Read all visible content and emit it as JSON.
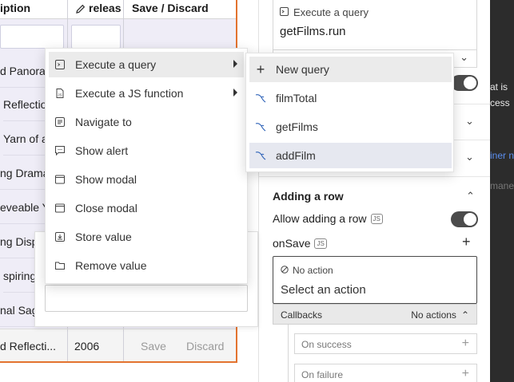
{
  "table": {
    "headers": {
      "description": "iption",
      "release": "releas",
      "save_discard": "Save / Discard"
    },
    "rows": [
      "d Panora...",
      "Reflectio",
      "Yarn of a",
      "ng Drama",
      "eveable Y",
      "ng Disp",
      "spiring",
      "nal Sag"
    ],
    "last_row": {
      "description": "d Reflecti...",
      "release": "2006",
      "save": "Save",
      "discard": "Discard"
    }
  },
  "query_block": {
    "header": "Execute a query",
    "value": "getFilms.run"
  },
  "adding_row": {
    "title": "Adding a row",
    "allow_label": "Allow adding a row",
    "js_badge": "JS",
    "onsave_label": "onSave",
    "action_header": "No action",
    "action_placeholder": "Select an action",
    "callbacks_label": "Callbacks",
    "callbacks_value": "No actions",
    "on_success": "On success",
    "on_failure": "On failure"
  },
  "strip": {
    "line1": "at is",
    "line2": "cess",
    "line3": "iner n",
    "line4": "mane"
  },
  "action_menu": {
    "items": [
      {
        "label": "Execute a query",
        "icon": "code-file-icon",
        "submenu": true
      },
      {
        "label": "Execute a JS function",
        "icon": "js-file-icon",
        "submenu": true
      },
      {
        "label": "Navigate to",
        "icon": "page-icon",
        "submenu": false
      },
      {
        "label": "Show alert",
        "icon": "chat-alert-icon",
        "submenu": false
      },
      {
        "label": "Show modal",
        "icon": "window-icon",
        "submenu": false
      },
      {
        "label": "Close modal",
        "icon": "window-close-icon",
        "submenu": false
      },
      {
        "label": "Store value",
        "icon": "save-box-icon",
        "submenu": false
      },
      {
        "label": "Remove value",
        "icon": "folder-icon",
        "submenu": false
      }
    ]
  },
  "query_menu": {
    "items": [
      {
        "label": "New query",
        "icon": "plus-icon"
      },
      {
        "label": "filmTotal",
        "icon": "mysql-icon"
      },
      {
        "label": "getFilms",
        "icon": "mysql-icon"
      },
      {
        "label": "addFilm",
        "icon": "mysql-icon"
      }
    ]
  }
}
